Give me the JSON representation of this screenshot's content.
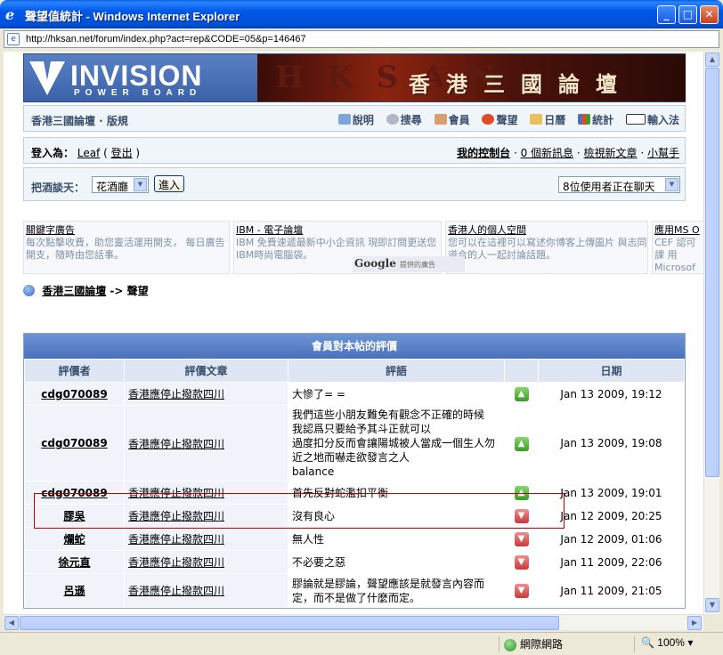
{
  "window": {
    "title": "聲望值統計 - Windows Internet Explorer",
    "url": "http://hksan.net/forum/index.php?act=rep&CODE=05&p=146467"
  },
  "banner": {
    "logo_big": "INVISION",
    "logo_small": "POWER BOARD",
    "art_text": "HKSAN",
    "site_name": "香港三國論壇"
  },
  "userbar": {
    "forum_title": "香港三國論壇 · 版規",
    "links": [
      "說明",
      "搜尋",
      "會員",
      "聲望",
      "日曆",
      "統計",
      "輸入法"
    ]
  },
  "loginbar": {
    "logged_in_as": "登入為：",
    "username": "Leaf",
    "logout": "登出",
    "control_panel": "我的控制台",
    "new_messages": "0 個新訊息",
    "view_new_posts": "檢視新文章",
    "helper": "小幫手"
  },
  "chatbar": {
    "label": "把酒談天：",
    "room_select": "花酒廳",
    "enter_button": "進入",
    "users_chatting": "8位使用者正在聊天"
  },
  "ads": [
    {
      "title": "關鍵字廣告",
      "body": "每次點擊收費，助您靈活運用開支， 每日廣告開支，隨時由您話事。"
    },
    {
      "title": "IBM - 電子論壇",
      "body": "IBM 免費速遞最新中小企資訊 現即訂閱更送您 IBM時尚電腦袋。"
    },
    {
      "title": "香港人的個人空間",
      "body": "您可以在這裡可以寫述你博客上傳圖片 與志同道合的人一起討論話題。"
    },
    {
      "title": "應用MS O",
      "body": "CEF 認可課 用Microsof"
    }
  ],
  "google_tag": {
    "brand": "Google",
    "label": "提供的廣告"
  },
  "breadcrumb": {
    "home": "香港三國論壇",
    "separator": " -> ",
    "current": "聲望"
  },
  "ratings": {
    "caption": "會員對本帖的評價",
    "headers": [
      "評價者",
      "評價文章",
      "評語",
      "",
      "日期"
    ],
    "rows": [
      {
        "rater": "cdg070089",
        "post": "香港應停止撥款四川",
        "comment": "大慘了= =",
        "vote": "up",
        "date": "Jan 13 2009, 19:12"
      },
      {
        "rater": "cdg070089",
        "post": "香港應停止撥款四川",
        "comment": "我們這些小朋友難免有觀念不正確的時候\n我認爲只要給予其斗正就可以\n過度扣分反而會讓陽城被人當成一個生人勿近之地而嚇走欲發言之人\nbalance",
        "vote": "up",
        "date": "Jan 13 2009, 19:08"
      },
      {
        "rater": "cdg070089",
        "post": "香港應停止撥款四川",
        "comment": "首先反對蛇濫扣平衡",
        "vote": "up",
        "date": "Jan 13 2009, 19:01"
      },
      {
        "rater": "膠吳",
        "post": "香港應停止撥款四川",
        "comment": "沒有良心",
        "vote": "down",
        "date": "Jan 12 2009, 20:25"
      },
      {
        "rater": "爛蛇",
        "post": "香港應停止撥款四川",
        "comment": "無人性",
        "vote": "down",
        "date": "Jan 12 2009, 01:06"
      },
      {
        "rater": "徐元直",
        "post": "香港應停止撥款四川",
        "comment": "不必要之惡",
        "vote": "down",
        "date": "Jan 11 2009, 22:06"
      },
      {
        "rater": "呂遜",
        "post": "香港應停止撥款四川",
        "comment": "膠論就是膠論，聲望應該是就發言內容而定，而不是做了什麼而定。",
        "vote": "down",
        "date": "Jan 11 2009, 21:05"
      }
    ]
  },
  "statusbar": {
    "zone": "網際網路",
    "zoom": "100%"
  },
  "colors": {
    "titlebar": "#0058e6",
    "header_blue": "#4a72bc",
    "vote_up": "#3c9a28",
    "vote_down": "#c83838",
    "highlight": "#c00000"
  }
}
